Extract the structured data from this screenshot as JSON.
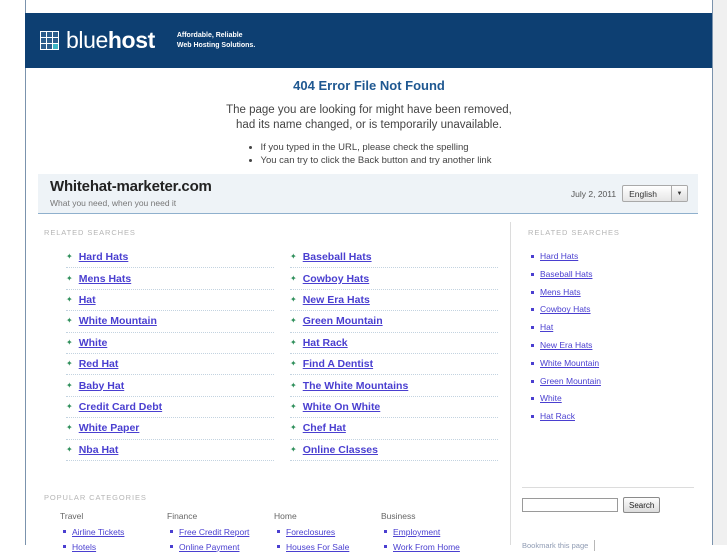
{
  "brand": {
    "logo_text_light": "blue",
    "logo_text_bold": "host",
    "logo_icon": "grid-icon",
    "tagline_line1": "Affordable, Reliable",
    "tagline_line2": "Web Hosting Solutions.",
    "header_color": "#0d3f72",
    "accent_color": "#3bb5c4"
  },
  "error": {
    "title": "404 Error File Not Found",
    "desc_line1": "The page you are looking for might have been removed,",
    "desc_line2": "had its name changed, or is temporarily unavailable.",
    "bullets": [
      "If you typed in the URL, please check the spelling",
      "You can try to click the Back button and try another link"
    ],
    "title_color": "#1f5891"
  },
  "domain": {
    "name": "Whitehat-marketer.com",
    "subtitle": "What you need, when you need it",
    "date": "July 2, 2011",
    "language_selected": "English",
    "language_options": [
      "English"
    ]
  },
  "main": {
    "section_label": "RELATED SEARCHES",
    "column_left": [
      "Hard Hats",
      "Mens Hats",
      "Hat",
      "White Mountain",
      "White",
      "Red Hat",
      "Baby Hat",
      "Credit Card Debt",
      "White Paper",
      "Nba Hat"
    ],
    "column_right": [
      "Baseball Hats",
      "Cowboy Hats",
      "New Era Hats",
      "Green Mountain",
      "Hat Rack",
      "Find A Dentist",
      "The White Mountains",
      "White On White",
      "Chef Hat",
      "Online Classes"
    ],
    "link_color": "#4a3fd0",
    "bullet_color": "#2f8f5b"
  },
  "popular": {
    "section_label": "POPULAR CATEGORIES",
    "categories": [
      {
        "heading": "Travel",
        "links": [
          "Airline Tickets",
          "Hotels"
        ]
      },
      {
        "heading": "Finance",
        "links": [
          "Free Credit Report",
          "Online Payment"
        ]
      },
      {
        "heading": "Home",
        "links": [
          "Foreclosures",
          "Houses For Sale"
        ]
      },
      {
        "heading": "Business",
        "links": [
          "Employment",
          "Work From Home"
        ]
      }
    ]
  },
  "sidebar": {
    "section_label": "RELATED SEARCHES",
    "links": [
      "Hard Hats",
      "Baseball Hats",
      "Mens Hats",
      "Cowboy Hats",
      "Hat",
      "New Era Hats",
      "White Mountain",
      "Green Mountain",
      "White",
      "Hat Rack"
    ],
    "search": {
      "value": "",
      "placeholder": "",
      "button_label": "Search"
    },
    "bookmark_label": "Bookmark this page"
  }
}
